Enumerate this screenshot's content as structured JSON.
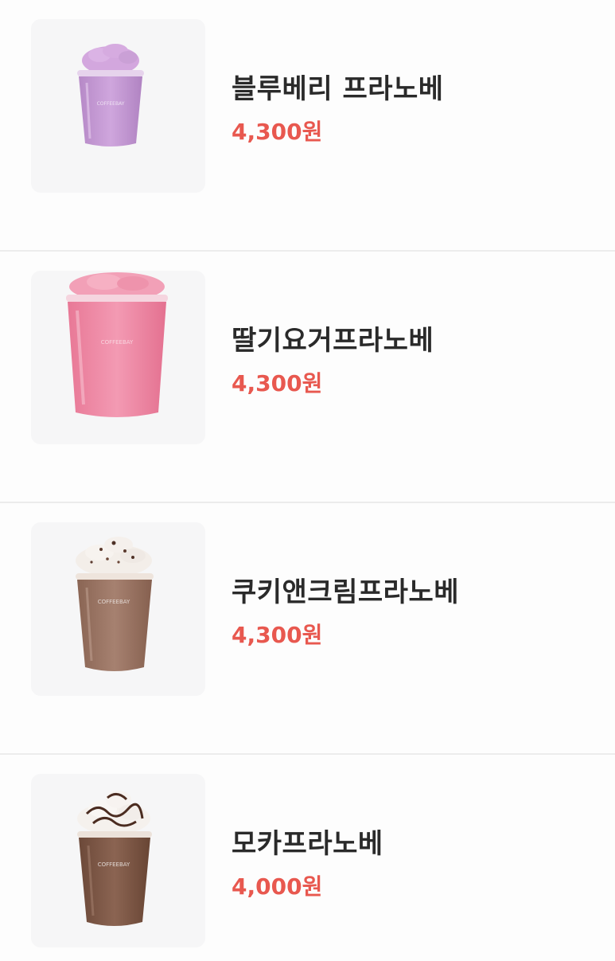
{
  "menu": {
    "items": [
      {
        "name": "블루베리 프라노베",
        "price": "4,300원",
        "cup_brand": "COFFEEBAY",
        "image_icon": "blueberry-frappe-cup-icon",
        "drink_color": "#c79bd6",
        "cream_color": "#d5a8df",
        "topping": "none"
      },
      {
        "name": "딸기요거프라노베",
        "price": "4,300원",
        "cup_brand": "COFFEEBAY",
        "image_icon": "strawberry-yogurt-frappe-cup-icon",
        "drink_color": "#ef8aa6",
        "cream_color": "#f29ab2",
        "topping": "none"
      },
      {
        "name": "쿠키앤크림프라노베",
        "price": "4,300원",
        "cup_brand": "COFFEEBAY",
        "image_icon": "cookies-and-cream-frappe-cup-icon",
        "drink_color": "#9a7564",
        "cream_color": "#f4efea",
        "topping": "cookie-crumbs"
      },
      {
        "name": "모카프라노베",
        "price": "4,000원",
        "cup_brand": "COFFEEBAY",
        "image_icon": "mocha-frappe-cup-icon",
        "drink_color": "#7a5544",
        "cream_color": "#f6f2ee",
        "topping": "chocolate-drizzle"
      }
    ]
  }
}
